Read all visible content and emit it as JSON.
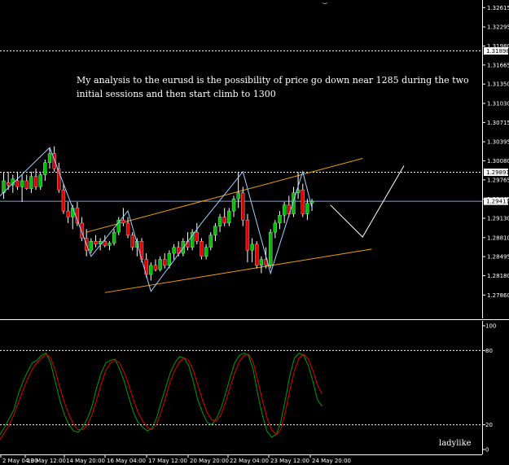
{
  "annotation": {
    "line1": "My analysis to the eurusd is the possibility of price go down near 1285 during the two",
    "line2": "initial sessions and then start climb to 1300"
  },
  "signature": "ladylike",
  "colors": {
    "background": "#000000",
    "bull": "#00c000",
    "bear": "#e00000",
    "channel": "#f0a000",
    "zigzag": "#9fd0ff",
    "current_price_line": "#7f9fdf",
    "forecast": "#ffffff",
    "stoch_main": "#00a000",
    "stoch_signal": "#e00000"
  },
  "chart_data": [
    {
      "type": "candlestick",
      "symbol": "EURUSD",
      "ylim": [
        1.275,
        1.327
      ],
      "ytick_labels": [
        "1.32615",
        "1.32295",
        "1.31980",
        "1.31665",
        "1.31350",
        "1.31030",
        "1.30715",
        "1.30395",
        "1.30080",
        "1.29765",
        "1.29445",
        "1.29130",
        "1.28810",
        "1.28495",
        "1.28180",
        "1.27860"
      ],
      "price_labels": [
        "1.31898",
        "1.29891",
        "1.29411"
      ],
      "horizontal_levels": [
        {
          "price": 1.31898,
          "style": "dotted"
        },
        {
          "price": 1.29891,
          "style": "dotted"
        },
        {
          "price": 1.29411,
          "style": "solid",
          "label": "current"
        }
      ],
      "xtick_labels": [
        "2 May 04:00",
        "13 May 12:00",
        "14 May 20:00",
        "16 May 04:00",
        "17 May 12:00",
        "20 May 20:00",
        "22 May 04:00",
        "23 May 12:00",
        "24 May 20:00"
      ],
      "candles": [
        {
          "o": 1.2955,
          "h": 1.299,
          "l": 1.2945,
          "c": 1.2975
        },
        {
          "o": 1.2972,
          "h": 1.299,
          "l": 1.296,
          "c": 1.2968
        },
        {
          "o": 1.2968,
          "h": 1.2985,
          "l": 1.2955,
          "c": 1.2978
        },
        {
          "o": 1.2975,
          "h": 1.299,
          "l": 1.296,
          "c": 1.2965
        },
        {
          "o": 1.2965,
          "h": 1.2985,
          "l": 1.294,
          "c": 1.2975
        },
        {
          "o": 1.2975,
          "h": 1.2985,
          "l": 1.296,
          "c": 1.2962
        },
        {
          "o": 1.2962,
          "h": 1.299,
          "l": 1.2955,
          "c": 1.2982
        },
        {
          "o": 1.2982,
          "h": 1.2995,
          "l": 1.296,
          "c": 1.2965
        },
        {
          "o": 1.2965,
          "h": 1.299,
          "l": 1.296,
          "c": 1.2985
        },
        {
          "o": 1.2985,
          "h": 1.301,
          "l": 1.2975,
          "c": 1.3005
        },
        {
          "o": 1.3005,
          "h": 1.303,
          "l": 1.2995,
          "c": 1.302
        },
        {
          "o": 1.302,
          "h": 1.3032,
          "l": 1.299,
          "c": 1.2995
        },
        {
          "o": 1.2995,
          "h": 1.3005,
          "l": 1.2955,
          "c": 1.296
        },
        {
          "o": 1.296,
          "h": 1.297,
          "l": 1.292,
          "c": 1.2925
        },
        {
          "o": 1.2925,
          "h": 1.294,
          "l": 1.2905,
          "c": 1.2915
        },
        {
          "o": 1.2915,
          "h": 1.2935,
          "l": 1.2895,
          "c": 1.293
        },
        {
          "o": 1.293,
          "h": 1.294,
          "l": 1.29,
          "c": 1.2905
        },
        {
          "o": 1.2905,
          "h": 1.2915,
          "l": 1.2875,
          "c": 1.288
        },
        {
          "o": 1.288,
          "h": 1.2895,
          "l": 1.285,
          "c": 1.286
        },
        {
          "o": 1.286,
          "h": 1.288,
          "l": 1.2855,
          "c": 1.2875
        },
        {
          "o": 1.2875,
          "h": 1.2885,
          "l": 1.2865,
          "c": 1.287
        },
        {
          "o": 1.287,
          "h": 1.288,
          "l": 1.286,
          "c": 1.2875
        },
        {
          "o": 1.2875,
          "h": 1.2885,
          "l": 1.2865,
          "c": 1.2868
        },
        {
          "o": 1.2868,
          "h": 1.2875,
          "l": 1.286,
          "c": 1.2872
        },
        {
          "o": 1.2872,
          "h": 1.2895,
          "l": 1.2868,
          "c": 1.289
        },
        {
          "o": 1.289,
          "h": 1.2915,
          "l": 1.2885,
          "c": 1.291
        },
        {
          "o": 1.291,
          "h": 1.293,
          "l": 1.29,
          "c": 1.2905
        },
        {
          "o": 1.2905,
          "h": 1.2915,
          "l": 1.288,
          "c": 1.2885
        },
        {
          "o": 1.2885,
          "h": 1.289,
          "l": 1.286,
          "c": 1.2865
        },
        {
          "o": 1.2865,
          "h": 1.288,
          "l": 1.285,
          "c": 1.2875
        },
        {
          "o": 1.2875,
          "h": 1.288,
          "l": 1.284,
          "c": 1.2845
        },
        {
          "o": 1.2845,
          "h": 1.2855,
          "l": 1.2815,
          "c": 1.282
        },
        {
          "o": 1.282,
          "h": 1.284,
          "l": 1.281,
          "c": 1.2835
        },
        {
          "o": 1.2835,
          "h": 1.2845,
          "l": 1.2825,
          "c": 1.2828
        },
        {
          "o": 1.2828,
          "h": 1.285,
          "l": 1.2825,
          "c": 1.2845
        },
        {
          "o": 1.2845,
          "h": 1.2855,
          "l": 1.283,
          "c": 1.2835
        },
        {
          "o": 1.2835,
          "h": 1.286,
          "l": 1.283,
          "c": 1.2855
        },
        {
          "o": 1.2855,
          "h": 1.287,
          "l": 1.2845,
          "c": 1.2865
        },
        {
          "o": 1.2865,
          "h": 1.2875,
          "l": 1.285,
          "c": 1.2855
        },
        {
          "o": 1.2855,
          "h": 1.288,
          "l": 1.285,
          "c": 1.2875
        },
        {
          "o": 1.2875,
          "h": 1.289,
          "l": 1.286,
          "c": 1.2865
        },
        {
          "o": 1.2865,
          "h": 1.2895,
          "l": 1.286,
          "c": 1.289
        },
        {
          "o": 1.289,
          "h": 1.2905,
          "l": 1.287,
          "c": 1.2875
        },
        {
          "o": 1.2875,
          "h": 1.288,
          "l": 1.2845,
          "c": 1.285
        },
        {
          "o": 1.285,
          "h": 1.287,
          "l": 1.2845,
          "c": 1.2865
        },
        {
          "o": 1.2865,
          "h": 1.289,
          "l": 1.286,
          "c": 1.2885
        },
        {
          "o": 1.2885,
          "h": 1.2905,
          "l": 1.2875,
          "c": 1.29
        },
        {
          "o": 1.29,
          "h": 1.292,
          "l": 1.289,
          "c": 1.2915
        },
        {
          "o": 1.2915,
          "h": 1.293,
          "l": 1.29,
          "c": 1.2905
        },
        {
          "o": 1.2905,
          "h": 1.293,
          "l": 1.29,
          "c": 1.2925
        },
        {
          "o": 1.2925,
          "h": 1.295,
          "l": 1.2915,
          "c": 1.2945
        },
        {
          "o": 1.2945,
          "h": 1.299,
          "l": 1.293,
          "c": 1.2955
        },
        {
          "o": 1.2955,
          "h": 1.2965,
          "l": 1.29,
          "c": 1.291
        },
        {
          "o": 1.291,
          "h": 1.292,
          "l": 1.284,
          "c": 1.286
        },
        {
          "o": 1.286,
          "h": 1.288,
          "l": 1.284,
          "c": 1.287
        },
        {
          "o": 1.287,
          "h": 1.2875,
          "l": 1.283,
          "c": 1.2835
        },
        {
          "o": 1.2835,
          "h": 1.285,
          "l": 1.2822,
          "c": 1.2845
        },
        {
          "o": 1.2845,
          "h": 1.2865,
          "l": 1.283,
          "c": 1.2835
        },
        {
          "o": 1.2835,
          "h": 1.2895,
          "l": 1.283,
          "c": 1.289
        },
        {
          "o": 1.289,
          "h": 1.291,
          "l": 1.288,
          "c": 1.2905
        },
        {
          "o": 1.2905,
          "h": 1.2925,
          "l": 1.2895,
          "c": 1.2918
        },
        {
          "o": 1.2918,
          "h": 1.294,
          "l": 1.2905,
          "c": 1.2935
        },
        {
          "o": 1.2935,
          "h": 1.295,
          "l": 1.2915,
          "c": 1.292
        },
        {
          "o": 1.292,
          "h": 1.2965,
          "l": 1.2915,
          "c": 1.2955
        },
        {
          "o": 1.2955,
          "h": 1.299,
          "l": 1.2945,
          "c": 1.296
        },
        {
          "o": 1.296,
          "h": 1.297,
          "l": 1.2915,
          "c": 1.292
        },
        {
          "o": 1.292,
          "h": 1.2945,
          "l": 1.291,
          "c": 1.2938
        },
        {
          "o": 1.2938,
          "h": 1.2945,
          "l": 1.2925,
          "c": 1.2941
        }
      ],
      "channel_lines": [
        {
          "from": {
            "i": 18,
            "p": 1.289
          },
          "to": {
            "i": 78,
            "p": 1.3012
          }
        },
        {
          "from": {
            "i": 22,
            "p": 1.279
          },
          "to": {
            "i": 80,
            "p": 1.2862
          }
        }
      ],
      "zigzag": [
        {
          "i": -2,
          "p": 1.2941
        },
        {
          "i": 10,
          "p": 1.303
        },
        {
          "i": 19,
          "p": 1.285
        },
        {
          "i": 27,
          "p": 1.2925
        },
        {
          "i": 32,
          "p": 1.2792
        },
        {
          "i": 43,
          "p": 1.2905
        },
        {
          "i": 52,
          "p": 1.299
        },
        {
          "i": 58,
          "p": 1.2822
        },
        {
          "i": 65,
          "p": 1.299
        },
        {
          "i": 67,
          "p": 1.293
        }
      ],
      "forecast_path": [
        {
          "i": 71,
          "p": 1.2935
        },
        {
          "i": 78,
          "p": 1.2882
        },
        {
          "i": 87,
          "p": 1.3
        }
      ]
    },
    {
      "type": "line",
      "indicator": "Stochastic",
      "ylim": [
        0,
        100
      ],
      "ytick_labels": [
        "100",
        "80",
        "20",
        "0"
      ],
      "levels": [
        80,
        20
      ],
      "series": [
        {
          "values": [
            12,
            18,
            25,
            32,
            45,
            55,
            63,
            70,
            72,
            76,
            78,
            70,
            55,
            40,
            28,
            20,
            15,
            14,
            18,
            25,
            35,
            50,
            62,
            70,
            72,
            73,
            65,
            55,
            42,
            30,
            22,
            18,
            15,
            17,
            25,
            38,
            50,
            62,
            70,
            75,
            74,
            68,
            55,
            40,
            30,
            22,
            20,
            25,
            33,
            45,
            58,
            70,
            76,
            78,
            76,
            65,
            45,
            28,
            15,
            10,
            12,
            22,
            40,
            60,
            74,
            78,
            76,
            68,
            55,
            40,
            35
          ]
        },
        {
          "values": [
            8,
            14,
            20,
            28,
            38,
            48,
            57,
            65,
            70,
            74,
            77,
            74,
            64,
            50,
            38,
            28,
            20,
            16,
            16,
            20,
            28,
            40,
            53,
            64,
            70,
            72,
            70,
            62,
            52,
            40,
            30,
            23,
            18,
            16,
            20,
            30,
            42,
            55,
            64,
            71,
            74,
            72,
            64,
            52,
            40,
            30,
            24,
            23,
            28,
            38,
            50,
            62,
            71,
            76,
            77,
            71,
            56,
            40,
            26,
            16,
            12,
            16,
            30,
            48,
            64,
            74,
            77,
            73,
            64,
            52,
            45
          ]
        }
      ]
    }
  ]
}
